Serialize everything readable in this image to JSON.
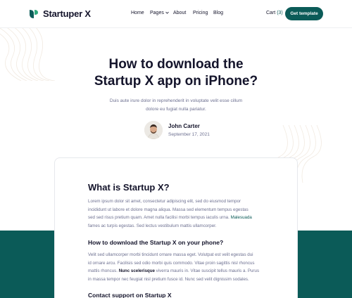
{
  "brand": {
    "name": "Startuper X"
  },
  "nav": {
    "items": [
      "Home",
      "Pages",
      "About",
      "Pricing",
      "Blog"
    ],
    "cart_label": "Cart",
    "cart_count": "(3)",
    "cta_label": "Get template"
  },
  "hero": {
    "title_line1": "How to download the",
    "title_line2": "Startup X app on iPhone?",
    "subtitle_line1": "Duis aute irure dolor in reprehenderit in voluptate velit esse cillum",
    "subtitle_line2": "dolore eu fugiat nulla pariatur.",
    "author_name": "John Carter",
    "author_date": "September 17, 2021"
  },
  "article": {
    "heading": "What is Startup X?",
    "para1": {
      "line1": "Lorem ipsum dolor sit amet, consectetur adipiscing elit, sed do eiusmod tempor",
      "line2": "incididunt ut labore et dolore magna aliqua. Massa sed elementum tempus egestas",
      "line3_before": "sed sed risus pretium quam. Amet nulla facilisi morbi tempus iaculis urna. ",
      "line3_link": "Malesuada",
      "line4": "fames ac turpis egestas. Sed lectus vestibulum mattis ullamcorper."
    },
    "subheading": "How to download the Startup X on your phone?",
    "para2": {
      "line1": "Velit sed ullamcorper morbi tincidunt ornare massa eget. Volutpat est velit egestas dui",
      "line2": "id ornare arcu. Facilisis sed odio morbi quis commodo. Vitae proin sagittis nisl rhoncus",
      "line3_before": "mattis rhoncus. ",
      "line3_bold": "Nunc scelerisque",
      "line3_after": " viverra mauris in. Vitae suscipit tellus mauris a. Purus",
      "line4": "in massa tempor nec feugiat nisl pretium fusce id. Nunc sed velit dignissim sodales."
    },
    "next_heading": "Contact support on Startup X"
  },
  "colors": {
    "accent": "#0b5b58",
    "text": "#14142b",
    "muted": "#6e7191"
  }
}
